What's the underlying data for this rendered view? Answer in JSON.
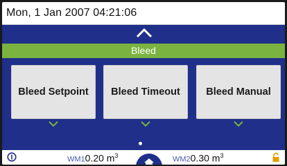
{
  "status_bar": {
    "datetime": "Mon, 1 Jan 2007 04:21:06"
  },
  "nav": {
    "up_icon": "chevron-up-icon"
  },
  "banner": {
    "label": "Bleed"
  },
  "tiles": [
    {
      "label": "Bleed Setpoint"
    },
    {
      "label": "Bleed Timeout"
    },
    {
      "label": "Bleed Manual"
    }
  ],
  "pager": {
    "current_page": 1,
    "page_count": 1
  },
  "bottom_bar": {
    "wm1": {
      "tag": "WM1",
      "value": "0.20 m",
      "unit_exp": "3"
    },
    "wm2": {
      "tag": "WM2",
      "value": "0.30 m",
      "unit_exp": "3"
    },
    "info_icon": "info-icon",
    "home_icon": "home-icon",
    "lock_icon": "lock-icon"
  },
  "colors": {
    "background": "#1f2f8a",
    "banner": "#7bb341",
    "chevron": "#7bb341",
    "lock": "#e0a100"
  }
}
